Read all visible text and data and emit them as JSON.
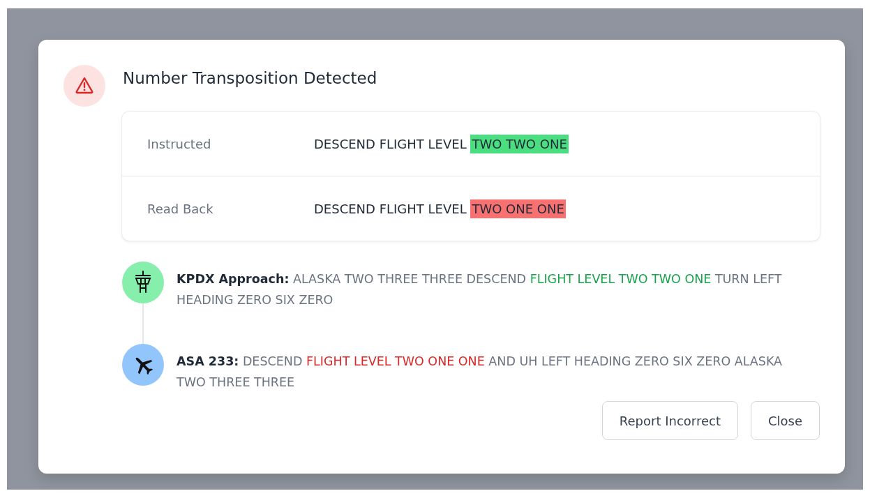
{
  "dialog": {
    "title": "Number Transposition Detected",
    "comparison": [
      {
        "label": "Instructed",
        "prefix": "DESCEND FLIGHT LEVEL ",
        "highlight": "TWO TWO ONE",
        "kind": "match"
      },
      {
        "label": "Read Back",
        "prefix": "DESCEND FLIGHT LEVEL ",
        "highlight": "TWO ONE ONE",
        "kind": "mismatch"
      }
    ],
    "transcript": [
      {
        "kind": "tower",
        "speaker": "KPDX Approach:",
        "segments": [
          {
            "text": "ALASKA TWO THREE THREE DESCEND ",
            "kind": "plain"
          },
          {
            "text": "FLIGHT LEVEL TWO TWO ONE",
            "kind": "match"
          },
          {
            "text": " TURN LEFT HEADING ZERO SIX ZERO",
            "kind": "plain"
          }
        ]
      },
      {
        "kind": "aircraft",
        "speaker": "ASA 233:",
        "segments": [
          {
            "text": "DESCEND ",
            "kind": "plain"
          },
          {
            "text": "FLIGHT LEVEL TWO ONE ONE",
            "kind": "mismatch"
          },
          {
            "text": " AND UH LEFT HEADING ZERO SIX ZERO ALASKA TWO THREE THREE",
            "kind": "plain"
          }
        ]
      }
    ],
    "buttons": [
      "Report Incorrect",
      "Close"
    ]
  }
}
